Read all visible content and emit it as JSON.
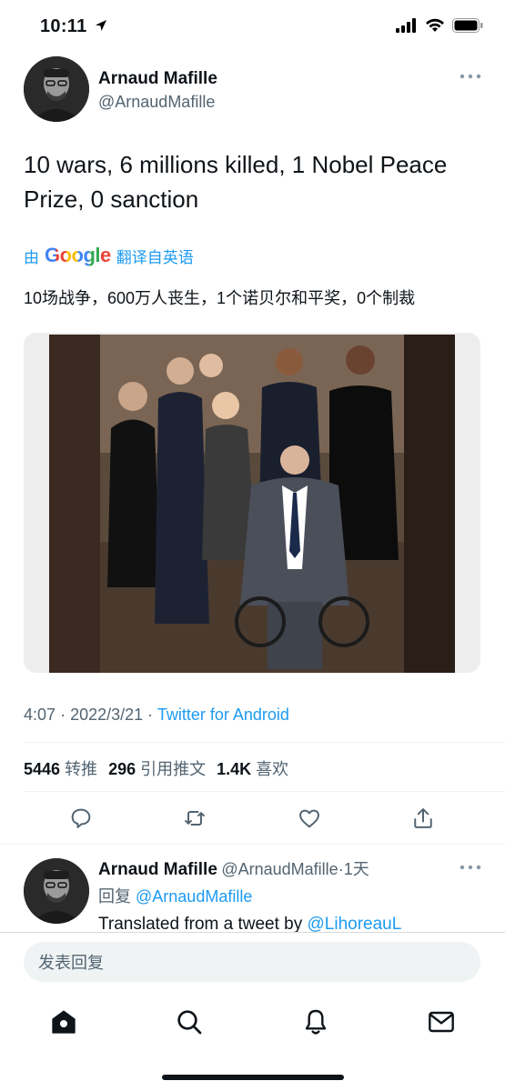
{
  "status_bar": {
    "time": "10:11"
  },
  "tweet": {
    "author_name": "Arnaud Mafille",
    "author_handle": "@ArnaudMafille",
    "text": "10 wars, 6 millions killed, 1 Nobel Peace Prize, 0 sanction",
    "translate_by": "由",
    "translate_provider": "Google",
    "translate_label": "翻译自英语",
    "translated_text": "10场战争，600万人丧生，1个诺贝尔和平奖，0个制裁",
    "time": "4:07",
    "date": "2022/3/21",
    "source": "Twitter for Android"
  },
  "stats": {
    "retweets_count": "5446",
    "retweets_label": "转推",
    "quotes_count": "296",
    "quotes_label": "引用推文",
    "likes_count": "1.4K",
    "likes_label": "喜欢"
  },
  "reply": {
    "author_name": "Arnaud Mafille",
    "author_handle": "@ArnaudMafille",
    "dot": "·",
    "age": "1天",
    "replying_prefix": "回复",
    "replying_to": "@ArnaudMafille",
    "text_prefix": "Translated from a tweet by",
    "text_mention": "@LihoreauL"
  },
  "compose": {
    "placeholder": "发表回复"
  },
  "icons": {
    "location": "location-arrow-icon",
    "signal": "cellular-signal-icon",
    "wifi": "wifi-icon",
    "battery": "battery-icon",
    "reply": "reply-icon",
    "retweet": "retweet-icon",
    "like": "heart-icon",
    "share": "share-icon",
    "home": "home-icon",
    "search": "search-icon",
    "notifications": "bell-icon",
    "messages": "mail-icon"
  },
  "colors": {
    "accent": "#1d9bf0",
    "text": "#0f1419",
    "secondary": "#536471"
  }
}
